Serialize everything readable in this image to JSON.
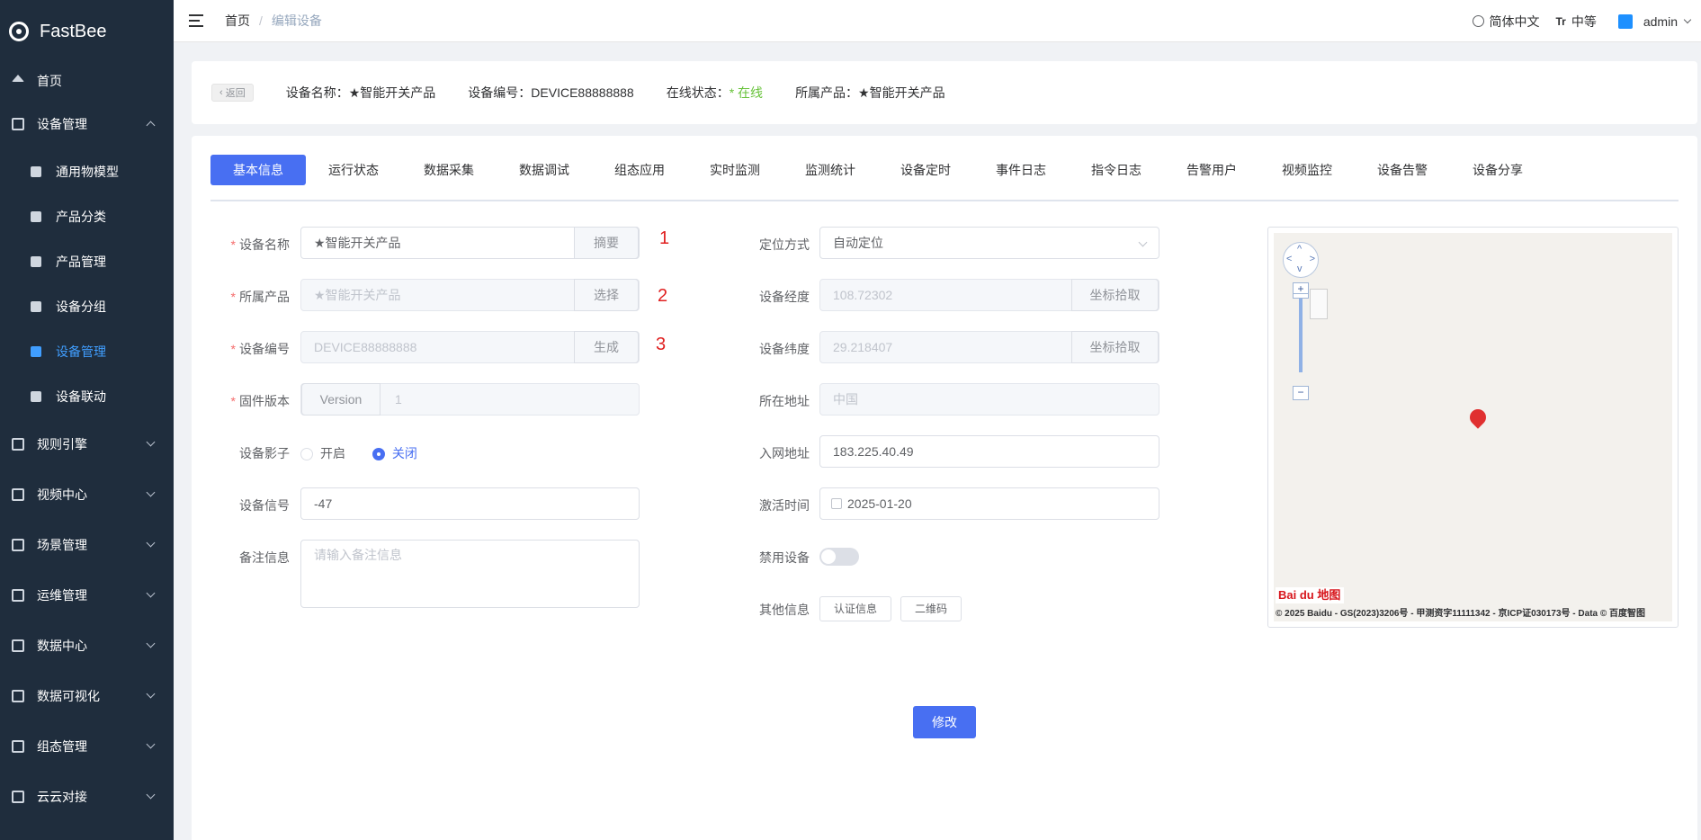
{
  "app": {
    "name": "FastBee"
  },
  "sidebar": {
    "items": [
      {
        "label": "首页"
      },
      {
        "label": "设备管理"
      },
      {
        "label": "规则引擎"
      },
      {
        "label": "视频中心"
      },
      {
        "label": "场景管理"
      },
      {
        "label": "运维管理"
      },
      {
        "label": "数据中心"
      },
      {
        "label": "数据可视化"
      },
      {
        "label": "组态管理"
      },
      {
        "label": "云云对接"
      }
    ],
    "sub_items": [
      {
        "label": "通用物模型"
      },
      {
        "label": "产品分类"
      },
      {
        "label": "产品管理"
      },
      {
        "label": "设备分组"
      },
      {
        "label": "设备管理",
        "active": true
      },
      {
        "label": "设备联动"
      }
    ]
  },
  "topbar": {
    "breadcrumb_home": "首页",
    "breadcrumb_sep": "/",
    "breadcrumb_current": "编辑设备",
    "language": "简体中文",
    "font_size_icon": "Tr",
    "font_size": "中等",
    "user": "admin"
  },
  "info": {
    "back": "返回",
    "device_name": "设备名称：★智能开关产品",
    "device_no_label": "设备编号：DEVICE88888888",
    "status_label": "在线状态：",
    "status_value": "* 在线",
    "product": "所属产品：★智能开关产品"
  },
  "tabs": [
    "基本信息",
    "运行状态",
    "数据采集",
    "数据调试",
    "组态应用",
    "实时监测",
    "监测统计",
    "设备定时",
    "事件日志",
    "指令日志",
    "告警用户",
    "视频监控",
    "设备告警",
    "设备分享"
  ],
  "form": {
    "device_name_label": "设备名称",
    "device_name_value": "★智能开关产品",
    "device_name_btn": "摘要",
    "product_label": "所属产品",
    "product_value": "★智能开关产品",
    "product_btn": "选择",
    "device_no_label": "设备编号",
    "device_no_value": "DEVICE88888888",
    "device_no_btn": "生成",
    "firmware_label": "固件版本",
    "firmware_prepend": "Version",
    "firmware_value": "1",
    "shadow_label": "设备影子",
    "shadow_on": "开启",
    "shadow_off": "关闭",
    "signal_label": "设备信号",
    "signal_value": "-47",
    "remark_label": "备注信息",
    "remark_placeholder": "请输入备注信息",
    "marks": [
      "1",
      "2",
      "3"
    ],
    "locate_label": "定位方式",
    "locate_value": "自动定位",
    "lng_label": "设备经度",
    "lng_value": "108.72302",
    "lng_btn": "坐标拾取",
    "lat_label": "设备纬度",
    "lat_value": "29.218407",
    "lat_btn": "坐标拾取",
    "address_label": "所在地址",
    "address_value": "中国",
    "network_label": "入网地址",
    "network_value": "183.225.40.49",
    "activate_label": "激活时间",
    "activate_value": "2025-01-20",
    "disable_label": "禁用设备",
    "other_label": "其他信息",
    "auth_btn": "认证信息",
    "qr_btn": "二维码",
    "submit": "修改"
  },
  "map": {
    "logo": "Bai du 地图",
    "zoom_in": "+",
    "zoom_out": "−",
    "copyright": "© 2025 Baidu - GS(2023)3206号 - 甲测资字11111342 - 京ICP证030173号 - Data © 百度智图"
  }
}
